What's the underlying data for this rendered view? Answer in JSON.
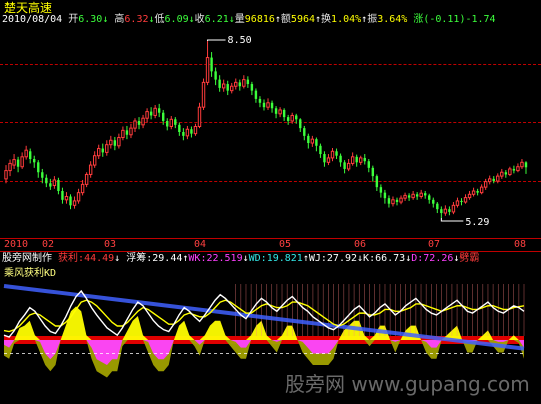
{
  "window": {
    "stock_name": "楚天高速"
  },
  "header": {
    "date": "2010/08/04",
    "open_label": "开",
    "open": "6.30",
    "high_label": "高",
    "high": "6.32",
    "low_label": "低",
    "low": "6.09",
    "close_label": "收",
    "close": "6.21",
    "volume_label": "量",
    "volume": "96816",
    "amount_label": "额",
    "amount": "5964",
    "turnover_label": "换",
    "turnover": "1.04%",
    "amplitude_label": "振",
    "amplitude": "3.64%",
    "change_label": "涨",
    "change": "(-0.11)-1.74"
  },
  "indicator": {
    "name": "股旁网制作",
    "profit_label": "获利:",
    "profit": "44.49",
    "float_label": "浮筹:",
    "float": "29.44",
    "wk_label": "WK:",
    "wk": "22.519",
    "wd_label": "WD:",
    "wd": "19.821",
    "wj_label": "WJ:",
    "wj": "27.92",
    "k_label": "K:",
    "k": "66.73",
    "d_label": "D:",
    "d": "72.26",
    "tail_label": "劈霸",
    "subtitle": "乘风获利KD"
  },
  "watermark": "股旁网 www.gupang.com",
  "colors": {
    "up": "#ff3c3c",
    "down": "#3cff3c",
    "yellow": "#ffff00",
    "cyan": "#33e6e6",
    "magenta": "#ff40ff",
    "background": "#000000",
    "separator": "#c00000"
  },
  "chart_data": [
    {
      "type": "candlestick",
      "title": "楚天高速",
      "x_ticks": [
        "2010",
        "02",
        "03",
        "04",
        "05",
        "06",
        "07",
        "08"
      ],
      "annotations": [
        {
          "label": "8.50",
          "value": 8.5
        },
        {
          "label": "5.29",
          "value": 5.29
        }
      ],
      "ylim": [
        5.0,
        8.7
      ],
      "candles": [
        [
          6.0,
          6.15,
          6.25,
          5.92
        ],
        [
          6.15,
          6.28,
          6.35,
          6.05
        ],
        [
          6.25,
          6.35,
          6.45,
          6.18
        ],
        [
          6.35,
          6.22,
          6.4,
          6.12
        ],
        [
          6.22,
          6.4,
          6.48,
          6.18
        ],
        [
          6.4,
          6.52,
          6.6,
          6.35
        ],
        [
          6.5,
          6.36,
          6.55,
          6.28
        ],
        [
          6.36,
          6.3,
          6.42,
          6.2
        ],
        [
          6.3,
          6.12,
          6.34,
          6.02
        ],
        [
          6.12,
          6.02,
          6.18,
          5.92
        ],
        [
          6.02,
          5.92,
          6.08,
          5.85
        ],
        [
          5.92,
          5.86,
          6.0,
          5.8
        ],
        [
          5.88,
          5.98,
          6.05,
          5.82
        ],
        [
          5.98,
          5.78,
          6.02,
          5.72
        ],
        [
          5.78,
          5.62,
          5.84,
          5.55
        ],
        [
          5.62,
          5.68,
          5.76,
          5.55
        ],
        [
          5.68,
          5.52,
          5.72,
          5.45
        ],
        [
          5.52,
          5.6,
          5.68,
          5.46
        ],
        [
          5.6,
          5.75,
          5.82,
          5.55
        ],
        [
          5.75,
          5.9,
          5.98,
          5.7
        ],
        [
          5.9,
          6.08,
          6.12,
          5.85
        ],
        [
          6.08,
          6.25,
          6.32,
          6.02
        ],
        [
          6.25,
          6.42,
          6.5,
          6.2
        ],
        [
          6.42,
          6.55,
          6.62,
          6.36
        ],
        [
          6.55,
          6.48,
          6.64,
          6.4
        ],
        [
          6.48,
          6.62,
          6.7,
          6.42
        ],
        [
          6.62,
          6.7,
          6.78,
          6.55
        ],
        [
          6.7,
          6.6,
          6.76,
          6.52
        ],
        [
          6.6,
          6.75,
          6.82,
          6.55
        ],
        [
          6.75,
          6.88,
          6.95,
          6.7
        ],
        [
          6.88,
          6.8,
          6.96,
          6.72
        ],
        [
          6.8,
          6.92,
          7.0,
          6.74
        ],
        [
          6.92,
          7.05,
          7.1,
          6.85
        ],
        [
          7.05,
          6.98,
          7.12,
          6.9
        ],
        [
          6.98,
          7.1,
          7.16,
          6.92
        ],
        [
          7.1,
          7.22,
          7.28,
          7.02
        ],
        [
          7.22,
          7.15,
          7.3,
          7.08
        ],
        [
          7.15,
          7.28,
          7.34,
          7.1
        ],
        [
          7.28,
          7.2,
          7.36,
          7.12
        ],
        [
          7.2,
          7.05,
          7.25,
          6.98
        ],
        [
          7.05,
          6.95,
          7.1,
          6.88
        ],
        [
          6.95,
          7.08,
          7.14,
          6.9
        ],
        [
          7.08,
          6.98,
          7.12,
          6.92
        ],
        [
          6.98,
          6.85,
          7.02,
          6.78
        ],
        [
          6.85,
          6.78,
          6.92,
          6.7
        ],
        [
          6.78,
          6.9,
          6.96,
          6.72
        ],
        [
          6.9,
          6.82,
          6.95,
          6.75
        ],
        [
          6.82,
          6.95,
          7.0,
          6.78
        ],
        [
          6.95,
          7.3,
          7.38,
          6.92
        ],
        [
          7.3,
          7.75,
          7.82,
          7.25
        ],
        [
          7.75,
          8.2,
          8.5,
          7.7
        ],
        [
          8.2,
          7.95,
          8.3,
          7.85
        ],
        [
          7.95,
          7.8,
          8.02,
          7.7
        ],
        [
          7.8,
          7.65,
          7.88,
          7.58
        ],
        [
          7.65,
          7.72,
          7.8,
          7.58
        ],
        [
          7.72,
          7.6,
          7.78,
          7.52
        ],
        [
          7.6,
          7.68,
          7.74,
          7.55
        ],
        [
          7.68,
          7.75,
          7.82,
          7.62
        ],
        [
          7.75,
          7.68,
          7.8,
          7.6
        ],
        [
          7.68,
          7.8,
          7.88,
          7.64
        ],
        [
          7.8,
          7.72,
          7.86,
          7.65
        ],
        [
          7.72,
          7.6,
          7.76,
          7.52
        ],
        [
          7.6,
          7.45,
          7.64,
          7.38
        ],
        [
          7.45,
          7.38,
          7.5,
          7.3
        ],
        [
          7.38,
          7.3,
          7.44,
          7.24
        ],
        [
          7.3,
          7.38,
          7.46,
          7.25
        ],
        [
          7.38,
          7.28,
          7.42,
          7.2
        ],
        [
          7.28,
          7.18,
          7.32,
          7.1
        ],
        [
          7.18,
          7.25,
          7.3,
          7.12
        ],
        [
          7.25,
          7.12,
          7.28,
          7.05
        ],
        [
          7.12,
          7.05,
          7.16,
          6.98
        ],
        [
          7.05,
          7.15,
          7.2,
          7.0
        ],
        [
          7.15,
          7.08,
          7.18,
          7.0
        ],
        [
          7.08,
          6.92,
          7.1,
          6.85
        ],
        [
          6.92,
          6.78,
          6.96,
          6.7
        ],
        [
          6.78,
          6.65,
          6.82,
          6.55
        ],
        [
          6.65,
          6.72,
          6.78,
          6.58
        ],
        [
          6.72,
          6.6,
          6.75,
          6.5
        ],
        [
          6.6,
          6.45,
          6.64,
          6.38
        ],
        [
          6.45,
          6.3,
          6.5,
          6.22
        ],
        [
          6.3,
          6.38,
          6.45,
          6.25
        ],
        [
          6.38,
          6.5,
          6.56,
          6.32
        ],
        [
          6.5,
          6.42,
          6.55,
          6.36
        ],
        [
          6.42,
          6.3,
          6.46,
          6.22
        ],
        [
          6.3,
          6.18,
          6.34,
          6.1
        ],
        [
          6.18,
          6.28,
          6.36,
          6.14
        ],
        [
          6.28,
          6.4,
          6.48,
          6.24
        ],
        [
          6.4,
          6.3,
          6.44,
          6.22
        ],
        [
          6.3,
          6.38,
          6.42,
          6.25
        ],
        [
          6.38,
          6.32,
          6.45,
          6.26
        ],
        [
          6.32,
          6.2,
          6.36,
          6.12
        ],
        [
          6.2,
          6.05,
          6.24,
          5.95
        ],
        [
          6.05,
          5.85,
          6.08,
          5.78
        ],
        [
          5.85,
          5.75,
          5.9,
          5.66
        ],
        [
          5.75,
          5.65,
          5.8,
          5.55
        ],
        [
          5.65,
          5.55,
          5.7,
          5.48
        ],
        [
          5.55,
          5.62,
          5.68,
          5.5
        ],
        [
          5.62,
          5.58,
          5.66,
          5.52
        ],
        [
          5.58,
          5.65,
          5.7,
          5.54
        ],
        [
          5.65,
          5.7,
          5.75,
          5.6
        ],
        [
          5.7,
          5.66,
          5.74,
          5.6
        ],
        [
          5.66,
          5.72,
          5.78,
          5.62
        ],
        [
          5.72,
          5.68,
          5.76,
          5.62
        ],
        [
          5.68,
          5.74,
          5.8,
          5.64
        ],
        [
          5.74,
          5.7,
          5.78,
          5.64
        ],
        [
          5.7,
          5.62,
          5.73,
          5.55
        ],
        [
          5.62,
          5.55,
          5.66,
          5.48
        ],
        [
          5.55,
          5.45,
          5.58,
          5.38
        ],
        [
          5.45,
          5.38,
          5.5,
          5.29
        ],
        [
          5.38,
          5.45,
          5.52,
          5.33
        ],
        [
          5.45,
          5.4,
          5.5,
          5.34
        ],
        [
          5.4,
          5.52,
          5.58,
          5.36
        ],
        [
          5.52,
          5.6,
          5.66,
          5.48
        ],
        [
          5.6,
          5.58,
          5.65,
          5.52
        ],
        [
          5.58,
          5.66,
          5.72,
          5.55
        ],
        [
          5.66,
          5.72,
          5.78,
          5.62
        ],
        [
          5.72,
          5.78,
          5.84,
          5.68
        ],
        [
          5.78,
          5.75,
          5.82,
          5.7
        ],
        [
          5.75,
          5.85,
          5.9,
          5.72
        ],
        [
          5.85,
          5.95,
          6.0,
          5.8
        ],
        [
          5.95,
          6.0,
          6.06,
          5.9
        ],
        [
          6.0,
          5.96,
          6.05,
          5.92
        ],
        [
          5.96,
          6.05,
          6.1,
          5.92
        ],
        [
          6.05,
          6.12,
          6.18,
          6.0
        ],
        [
          6.12,
          6.08,
          6.16,
          6.02
        ],
        [
          6.08,
          6.18,
          6.22,
          6.05
        ],
        [
          6.18,
          6.15,
          6.24,
          6.1
        ],
        [
          6.15,
          6.22,
          6.28,
          6.12
        ],
        [
          6.22,
          6.3,
          6.36,
          6.18
        ],
        [
          6.3,
          6.21,
          6.32,
          6.09
        ]
      ]
    },
    {
      "type": "indicator",
      "title": "乘风获利KD",
      "series": [
        {
          "name": "K",
          "color": "#ffffff",
          "values": [
            40,
            38,
            45,
            55,
            62,
            70,
            66,
            58,
            50,
            44,
            42,
            50,
            60,
            72,
            82,
            88,
            80,
            70,
            62,
            55,
            48,
            44,
            40,
            48,
            58,
            68,
            76,
            72,
            64,
            56,
            50,
            46,
            44,
            52,
            62,
            70,
            66,
            60,
            55,
            62,
            70,
            78,
            84,
            80,
            74,
            68,
            62,
            58,
            66,
            74,
            80,
            76,
            70,
            66,
            72,
            78,
            82,
            76,
            70,
            66,
            60,
            56,
            52,
            48,
            46,
            50,
            56,
            62,
            68,
            72,
            66,
            60,
            64,
            70,
            74,
            68,
            62,
            66,
            72,
            76,
            80,
            74,
            68,
            64,
            62,
            66,
            70,
            74,
            78,
            72,
            66,
            64,
            68,
            72,
            76,
            70,
            66,
            64,
            68,
            72,
            70,
            66
          ]
        },
        {
          "name": "D",
          "color": "#ffff00",
          "values": [
            45,
            44,
            46,
            50,
            56,
            62,
            64,
            62,
            58,
            54,
            50,
            50,
            54,
            60,
            68,
            76,
            78,
            76,
            72,
            66,
            60,
            54,
            50,
            50,
            54,
            60,
            66,
            70,
            68,
            64,
            60,
            56,
            52,
            52,
            56,
            62,
            64,
            62,
            60,
            60,
            64,
            70,
            76,
            78,
            76,
            72,
            68,
            64,
            64,
            68,
            72,
            74,
            72,
            70,
            70,
            72,
            76,
            76,
            74,
            72,
            68,
            64,
            60,
            56,
            52,
            50,
            52,
            56,
            60,
            64,
            64,
            62,
            62,
            64,
            68,
            68,
            66,
            66,
            68,
            70,
            74,
            74,
            72,
            70,
            68,
            66,
            68,
            70,
            72,
            72,
            70,
            68,
            68,
            70,
            72,
            72,
            70,
            68,
            68,
            70,
            71,
            72
          ]
        }
      ]
    }
  ]
}
